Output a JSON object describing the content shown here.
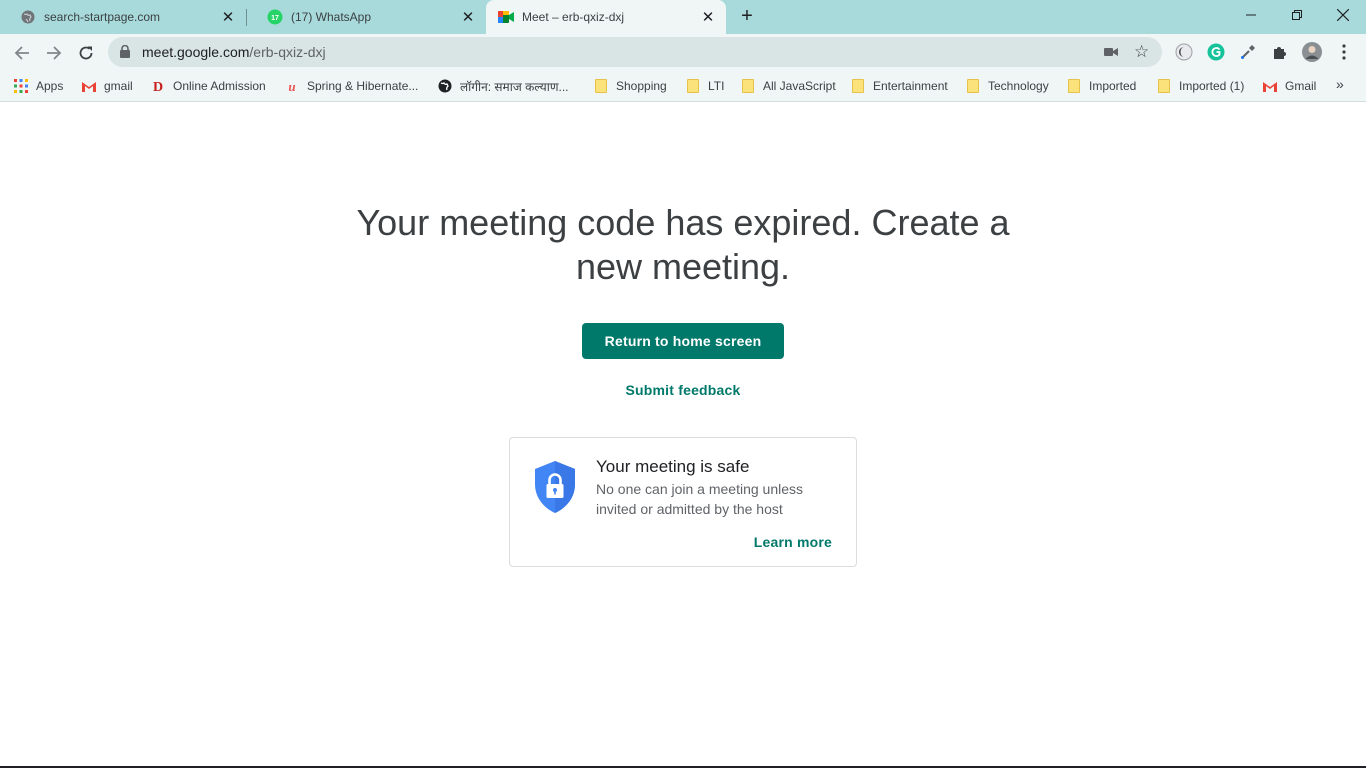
{
  "browser": {
    "tabs": [
      {
        "title": "search-startpage.com",
        "icon": "globe-icon",
        "active": false
      },
      {
        "title": "(17) WhatsApp",
        "icon": "whatsapp-icon",
        "badge": "17",
        "active": false
      },
      {
        "title": "Meet – erb-qxiz-dxj",
        "icon": "meet-icon",
        "active": true
      }
    ],
    "close_glyph": "✕",
    "new_tab_glyph": "+",
    "window_controls": {
      "minimize": "—",
      "restore": "❐",
      "close": "✕"
    },
    "address": {
      "host": "meet.google.com",
      "path": "/erb-qxiz-dxj"
    },
    "bookmarks": [
      {
        "label": "Apps",
        "icon": "apps-grid-icon"
      },
      {
        "label": "gmail",
        "icon": "gmail-icon"
      },
      {
        "label": "Online Admission",
        "icon": "d-logo-icon"
      },
      {
        "label": "Spring & Hibernate...",
        "icon": "udemy-icon"
      },
      {
        "label": "लॉगीन: समाज कल्याण...",
        "icon": "globe-dark-icon"
      },
      {
        "label": "Shopping",
        "icon": "folder-icon"
      },
      {
        "label": "LTI",
        "icon": "folder-icon"
      },
      {
        "label": "All JavaScript",
        "icon": "folder-icon"
      },
      {
        "label": "Entertainment",
        "icon": "folder-icon"
      },
      {
        "label": "Technology",
        "icon": "folder-icon"
      },
      {
        "label": "Imported",
        "icon": "folder-icon"
      },
      {
        "label": "Imported (1)",
        "icon": "folder-icon"
      },
      {
        "label": "Gmail",
        "icon": "gmail-icon"
      }
    ],
    "bookmarks_overflow": "»"
  },
  "page": {
    "headline": "Your meeting code has expired. Create a new meeting.",
    "home_button": "Return to home screen",
    "feedback_link": "Submit feedback",
    "safety_card": {
      "title": "Your meeting is safe",
      "body": "No one can join a meeting unless invited or admitted by the host",
      "link": "Learn more"
    }
  },
  "colors": {
    "accent": "#00796b",
    "tabstrip": "#a8dadb",
    "toolbar": "#f0f6f6",
    "shield": "#4285f4"
  }
}
